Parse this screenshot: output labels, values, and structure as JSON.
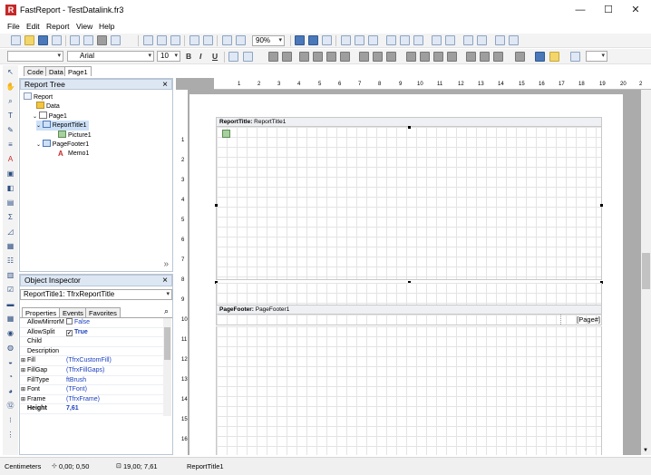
{
  "window": {
    "title": "FastReport - TestDatalink.fr3",
    "minimize_glyph": "—",
    "maximize_glyph": "☐",
    "close_glyph": "✕"
  },
  "menu": [
    "File",
    "Edit",
    "Report",
    "View",
    "Help"
  ],
  "toolbar": {
    "zoom": "90%",
    "font_name": "Arial",
    "font_size": "10",
    "bold_glyph": "B",
    "italic_glyph": "I",
    "underline_glyph": "U"
  },
  "design_tabs": [
    "Code",
    "Data",
    "Page1"
  ],
  "report_tree": {
    "header": "Report Tree",
    "items": [
      {
        "label": "Report",
        "icon": "report-icon"
      },
      {
        "label": "Data",
        "icon": "database-icon"
      },
      {
        "label": "Page1",
        "icon": "page-icon"
      },
      {
        "label": "ReportTitle1",
        "icon": "band-icon"
      },
      {
        "label": "Picture1",
        "icon": "picture-icon"
      },
      {
        "label": "PageFooter1",
        "icon": "band-icon"
      },
      {
        "label": "Memo1",
        "icon": "memo-icon"
      }
    ],
    "memo_glyph": "A",
    "expand_glyph": "»"
  },
  "object_inspector": {
    "header": "Object Inspector",
    "selected_object": "ReportTitle1: TfrxReportTitle",
    "tabs": [
      "Properties",
      "Events",
      "Favorites"
    ],
    "properties": [
      {
        "name": "AllowMirrorM",
        "value": "False",
        "checkbox": true
      },
      {
        "name": "AllowSplit",
        "value": "True",
        "checkbox": true,
        "bold_value": true
      },
      {
        "name": "Child",
        "value": ""
      },
      {
        "name": "Description",
        "value": ""
      },
      {
        "name": "Fill",
        "value": "(TfrxCustomFill)",
        "expandable": true
      },
      {
        "name": "FillGap",
        "value": "(TfrxFillGaps)",
        "expandable": true
      },
      {
        "name": "FillType",
        "value": "ftBrush"
      },
      {
        "name": "Font",
        "value": "(TFont)",
        "expandable": true
      },
      {
        "name": "Frame",
        "value": "(TfrxFrame)",
        "expandable": true
      },
      {
        "name": "Height",
        "value": "7,61",
        "bold": true
      }
    ]
  },
  "ruler": {
    "h_numbers": [
      "1",
      "2",
      "3",
      "4",
      "5",
      "6",
      "7",
      "8",
      "9",
      "10",
      "11",
      "12",
      "13",
      "14",
      "15",
      "16",
      "17",
      "18",
      "19",
      "20",
      "2"
    ],
    "v_numbers": [
      "1",
      "2",
      "3",
      "4",
      "5",
      "6",
      "7",
      "8",
      "9",
      "10",
      "11",
      "12",
      "13",
      "14",
      "15",
      "16"
    ]
  },
  "bands": {
    "report_title": {
      "label": "ReportTitle:",
      "name": "ReportTitle1"
    },
    "page_footer": {
      "label": "PageFooter:",
      "name": "PageFooter1"
    },
    "memo_text": "[Page#]"
  },
  "statusbar": {
    "units": "Centimeters",
    "position": "0,00; 0,50",
    "size": "19,00; 7,61",
    "selected": "ReportTitle1"
  },
  "colors": {
    "panel_header": "#dde7f3",
    "accent": "#4a78b8",
    "property_value": "#1a3fbf"
  }
}
